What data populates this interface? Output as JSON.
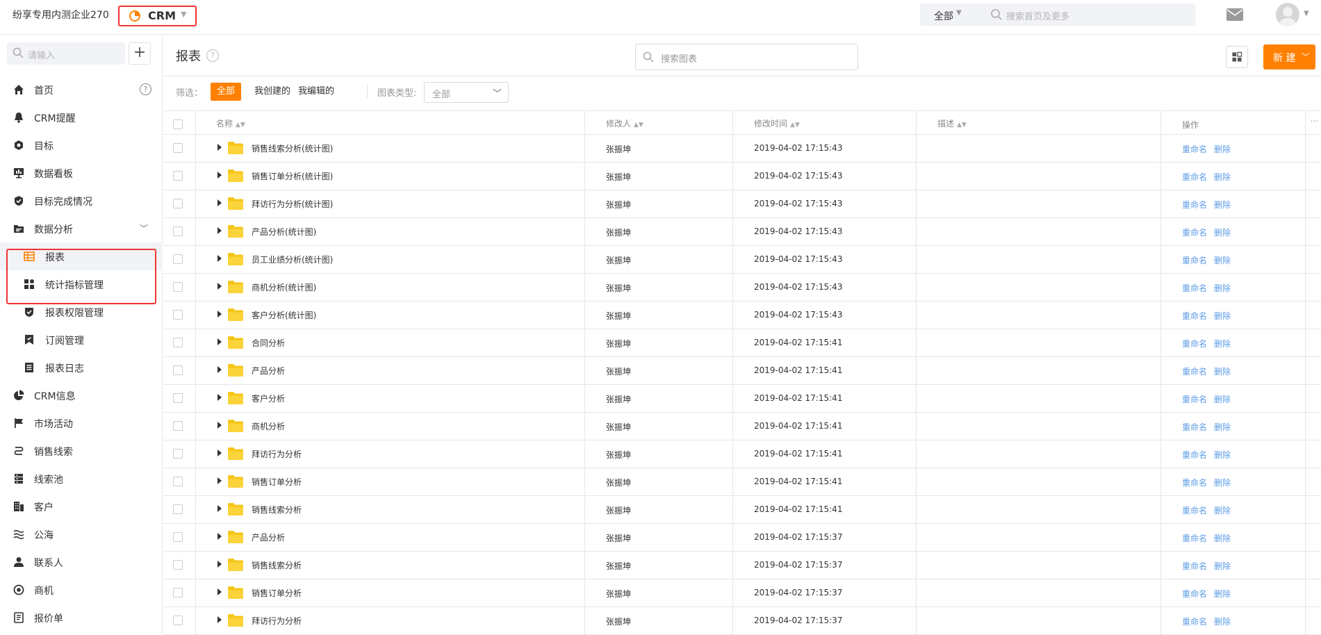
{
  "topbar": {
    "company": "纷享专用内测企业270",
    "app_name": "CRM",
    "search_scope": "全部",
    "search_placeholder": "搜索首页及更多"
  },
  "sidebar": {
    "search_placeholder": "请输入",
    "add_label": "+",
    "items": [
      {
        "label": "首页",
        "icon": "home-icon"
      },
      {
        "label": "CRM提醒",
        "icon": "bell-icon"
      },
      {
        "label": "目标",
        "icon": "target-icon"
      },
      {
        "label": "数据看板",
        "icon": "dashboard-icon"
      },
      {
        "label": "目标完成情况",
        "icon": "shield-check-icon"
      },
      {
        "label": "数据分析",
        "icon": "folder-icon"
      },
      {
        "label": "报表",
        "icon": "report-table-icon"
      },
      {
        "label": "统计指标管理",
        "icon": "grid-icon"
      },
      {
        "label": "报表权限管理",
        "icon": "permission-icon"
      },
      {
        "label": "订阅管理",
        "icon": "bookmark-icon"
      },
      {
        "label": "报表日志",
        "icon": "log-icon"
      },
      {
        "label": "CRM信息",
        "icon": "pie-icon"
      },
      {
        "label": "市场活动",
        "icon": "flag-icon"
      },
      {
        "label": "销售线索",
        "icon": "lead-icon"
      },
      {
        "label": "线索池",
        "icon": "pool-icon"
      },
      {
        "label": "客户",
        "icon": "customer-icon"
      },
      {
        "label": "公海",
        "icon": "sea-icon"
      },
      {
        "label": "联系人",
        "icon": "contact-icon"
      },
      {
        "label": "商机",
        "icon": "opportunity-icon"
      },
      {
        "label": "报价单",
        "icon": "quote-icon"
      }
    ]
  },
  "main": {
    "title": "报表",
    "search_placeholder": "搜索图表",
    "new_button": "新 建",
    "filter": {
      "label": "筛选：",
      "chips": [
        "全部",
        "我创建的",
        "我编辑的"
      ],
      "type_label": "图表类型:",
      "type_value": "全部"
    },
    "columns": {
      "name": "名称",
      "modifier": "修改人",
      "mtime": "修改时间",
      "desc": "描述",
      "ops": "操作"
    },
    "ops": {
      "rename": "重命名",
      "delete": "删除"
    },
    "rows": [
      {
        "name": "销售线索分析(统计图)",
        "modifier": "张振坤",
        "mtime": "2019-04-02 17:15:43"
      },
      {
        "name": "销售订单分析(统计图)",
        "modifier": "张振坤",
        "mtime": "2019-04-02 17:15:43"
      },
      {
        "name": "拜访行为分析(统计图)",
        "modifier": "张振坤",
        "mtime": "2019-04-02 17:15:43"
      },
      {
        "name": "产品分析(统计图)",
        "modifier": "张振坤",
        "mtime": "2019-04-02 17:15:43"
      },
      {
        "name": "员工业绩分析(统计图)",
        "modifier": "张振坤",
        "mtime": "2019-04-02 17:15:43"
      },
      {
        "name": "商机分析(统计图)",
        "modifier": "张振坤",
        "mtime": "2019-04-02 17:15:43"
      },
      {
        "name": "客户分析(统计图)",
        "modifier": "张振坤",
        "mtime": "2019-04-02 17:15:43"
      },
      {
        "name": "合同分析",
        "modifier": "张振坤",
        "mtime": "2019-04-02 17:15:41"
      },
      {
        "name": "产品分析",
        "modifier": "张振坤",
        "mtime": "2019-04-02 17:15:41"
      },
      {
        "name": "客户分析",
        "modifier": "张振坤",
        "mtime": "2019-04-02 17:15:41"
      },
      {
        "name": "商机分析",
        "modifier": "张振坤",
        "mtime": "2019-04-02 17:15:41"
      },
      {
        "name": "拜访行为分析",
        "modifier": "张振坤",
        "mtime": "2019-04-02 17:15:41"
      },
      {
        "name": "销售订单分析",
        "modifier": "张振坤",
        "mtime": "2019-04-02 17:15:41"
      },
      {
        "name": "销售线索分析",
        "modifier": "张振坤",
        "mtime": "2019-04-02 17:15:41"
      },
      {
        "name": "产品分析",
        "modifier": "张振坤",
        "mtime": "2019-04-02 17:15:37"
      },
      {
        "name": "销售线索分析",
        "modifier": "张振坤",
        "mtime": "2019-04-02 17:15:37"
      },
      {
        "name": "销售订单分析",
        "modifier": "张振坤",
        "mtime": "2019-04-02 17:15:37"
      },
      {
        "name": "拜访行为分析",
        "modifier": "张振坤",
        "mtime": "2019-04-02 17:15:37"
      }
    ]
  },
  "colors": {
    "accent": "#ff8000",
    "link": "#5c9ce6",
    "highlight": "#ee3333",
    "folder": "#f5c518"
  }
}
